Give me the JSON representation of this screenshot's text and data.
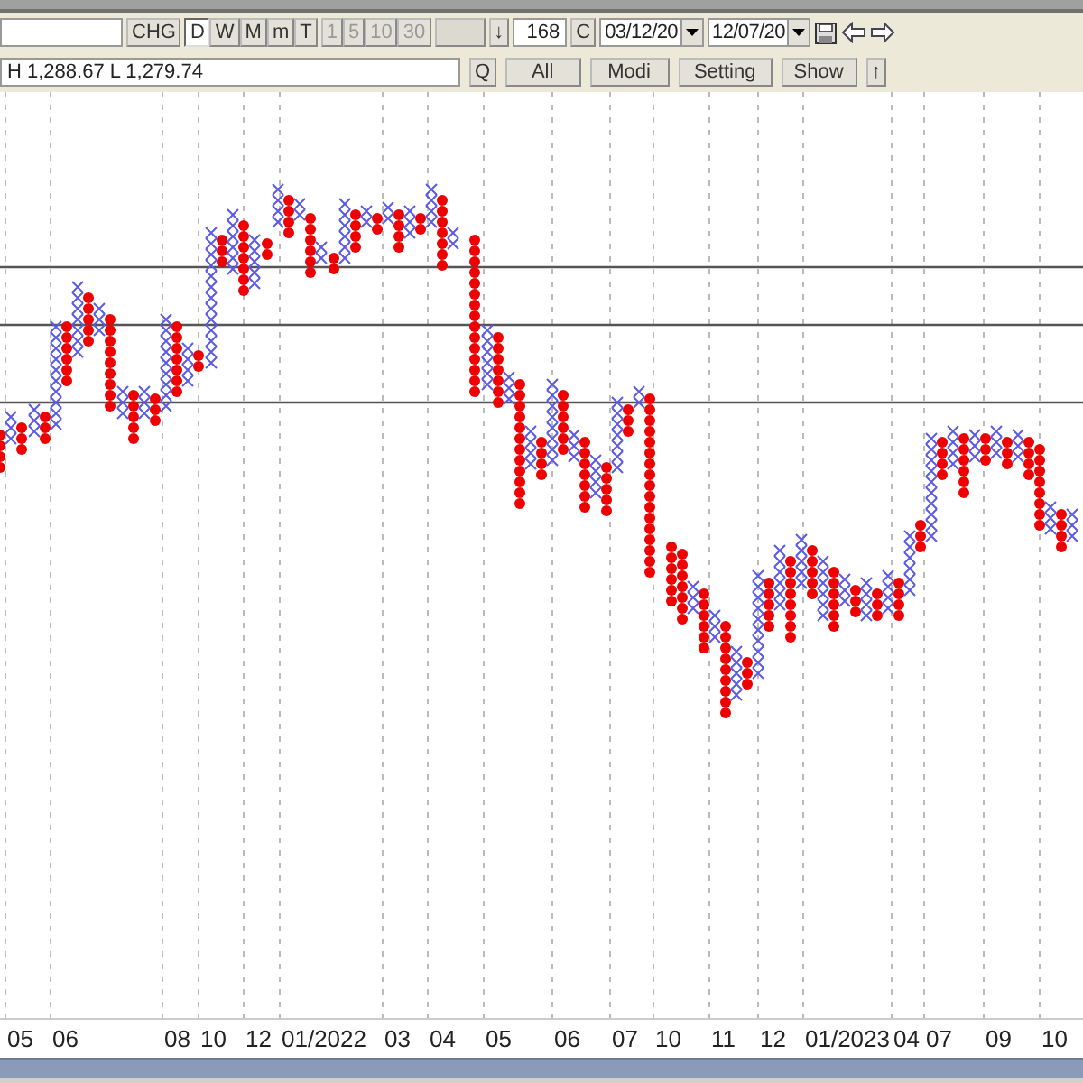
{
  "toolbar": {
    "chg_button": "CHG",
    "periods": [
      {
        "label": "D",
        "selected": true
      },
      {
        "label": "W",
        "selected": false
      },
      {
        "label": "M",
        "selected": false
      },
      {
        "label": "m",
        "selected": false
      },
      {
        "label": "T",
        "selected": false
      }
    ],
    "intervals": [
      {
        "label": "1",
        "disabled": true
      },
      {
        "label": "5",
        "disabled": true
      },
      {
        "label": "10",
        "disabled": true
      },
      {
        "label": "30",
        "disabled": true
      }
    ],
    "down_button": "↓",
    "count_field": {
      "value": "168"
    },
    "c_button": "C",
    "start_date": {
      "value": "03/12/20"
    },
    "end_date": {
      "value": "12/07/20"
    },
    "quote_field": {
      "value": "H 1,288.67 L 1,279.74"
    },
    "buttons": [
      "Q",
      "All",
      "Modi",
      "Setting",
      "Show"
    ],
    "up_button": "↑"
  },
  "chart": {
    "x_axis_labels": [
      "05",
      "06",
      "08",
      "10",
      "12",
      "01/2022",
      "03",
      "04",
      "05",
      "06",
      "07",
      "10",
      "11",
      "12",
      "01/2023",
      "04",
      "07",
      "09",
      "10"
    ]
  }
}
